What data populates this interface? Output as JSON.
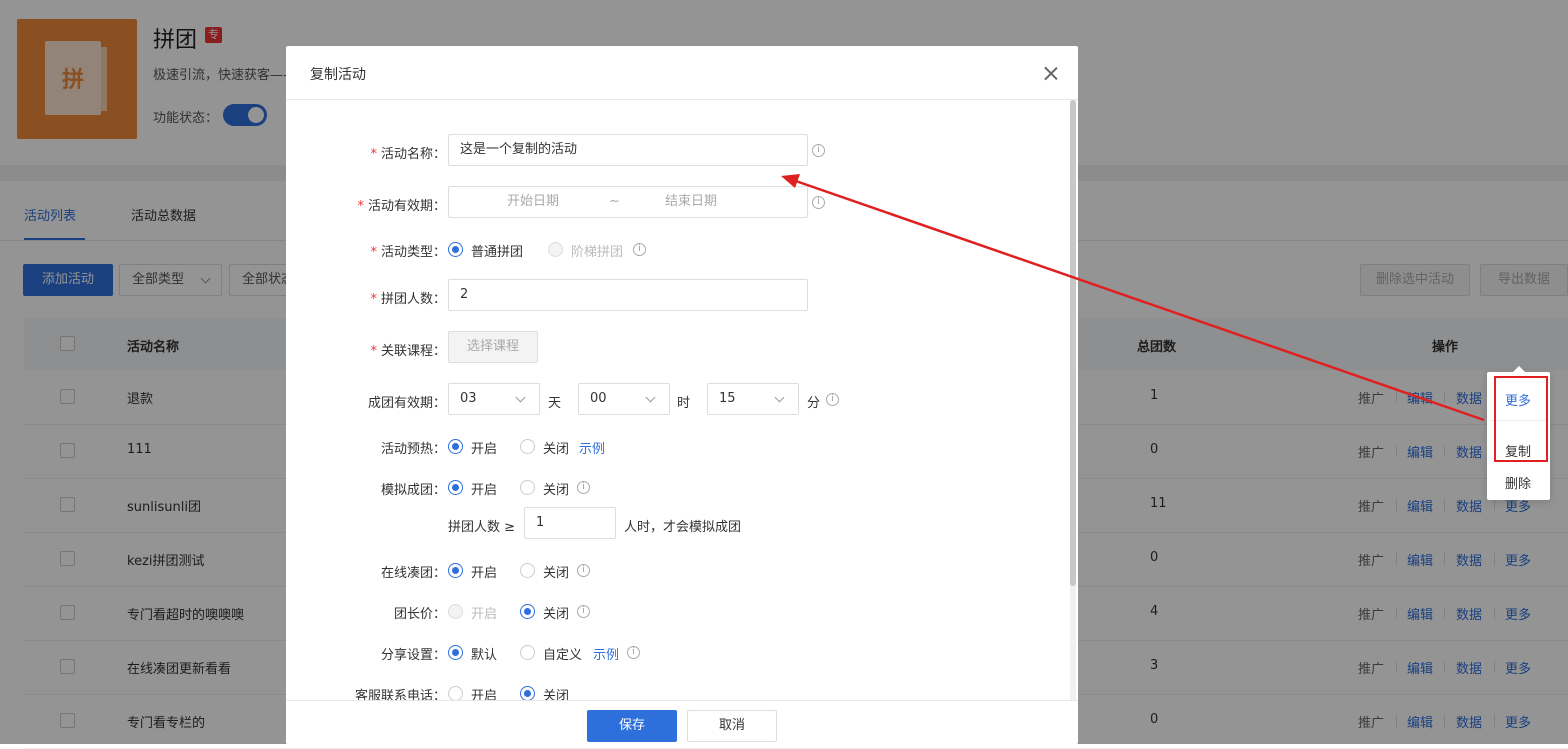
{
  "app": {
    "title": "拼团",
    "badge": "专",
    "description": "极速引流，快速获客——",
    "status_label": "功能状态：",
    "logo_char": "拼"
  },
  "tabs": [
    {
      "label": "活动列表",
      "active": true
    },
    {
      "label": "活动总数据",
      "active": false
    }
  ],
  "toolbar": {
    "add_label": "添加活动",
    "type_filter": "全部类型",
    "status_filter": "全部状态",
    "delete_selected_label": "删除选中活动",
    "export_label": "导出数据"
  },
  "table": {
    "headers": {
      "name": "活动名称",
      "total_groups": "总团数",
      "ops": "操作"
    },
    "rows": [
      {
        "name": "退款",
        "total": "1"
      },
      {
        "name": "111",
        "total": "0"
      },
      {
        "name": "sunlisunli团",
        "total": "11"
      },
      {
        "name": "kezi拼团测试",
        "total": "0"
      },
      {
        "name": "专门看超时的噢噢噢",
        "total": "4"
      },
      {
        "name": "在线凑团更新看看",
        "total": "3"
      },
      {
        "name": "专门看专栏的",
        "total": "0"
      }
    ],
    "ops": {
      "promote": "推广",
      "edit": "编辑",
      "data": "数据",
      "more": "更多"
    }
  },
  "more_menu": {
    "items": [
      "复制",
      "删除"
    ]
  },
  "modal": {
    "title": "复制活动",
    "fields": {
      "name": {
        "label": "活动名称：",
        "value": "这是一个复制的活动"
      },
      "validity": {
        "label": "活动有效期：",
        "start_placeholder": "开始日期",
        "sep": "~",
        "end_placeholder": "结束日期"
      },
      "type": {
        "label": "活动类型：",
        "opt1": "普通拼团",
        "opt2": "阶梯拼团"
      },
      "group_size": {
        "label": "拼团人数：",
        "value": "2"
      },
      "course": {
        "label": "关联课程：",
        "button": "选择课程"
      },
      "group_validity": {
        "label": "成团有效期：",
        "days": "03",
        "days_unit": "天",
        "hours": "00",
        "hours_unit": "时",
        "minutes": "15",
        "minutes_unit": "分"
      },
      "preheat": {
        "label": "活动预热：",
        "on": "开启",
        "off": "关闭",
        "example": "示例"
      },
      "simulate": {
        "label": "模拟成团：",
        "on": "开启",
        "off": "关闭",
        "sub_label": "拼团人数 ≥",
        "sub_value": "1",
        "sub_suffix": "人时，才会模拟成团"
      },
      "online": {
        "label": "在线凑团：",
        "on": "开启",
        "off": "关闭"
      },
      "leader_price": {
        "label": "团长价：",
        "on": "开启",
        "off": "关闭"
      },
      "share": {
        "label": "分享设置：",
        "default": "默认",
        "custom": "自定义",
        "example": "示例"
      },
      "service_phone": {
        "label": "客服联系电话：",
        "on": "开启",
        "off": "关闭"
      }
    },
    "save": "保存",
    "cancel": "取消"
  },
  "colors": {
    "accent": "#2d6fdb",
    "required": "#e33333",
    "annotation": "#e02020",
    "logo": "#f08a3c"
  }
}
